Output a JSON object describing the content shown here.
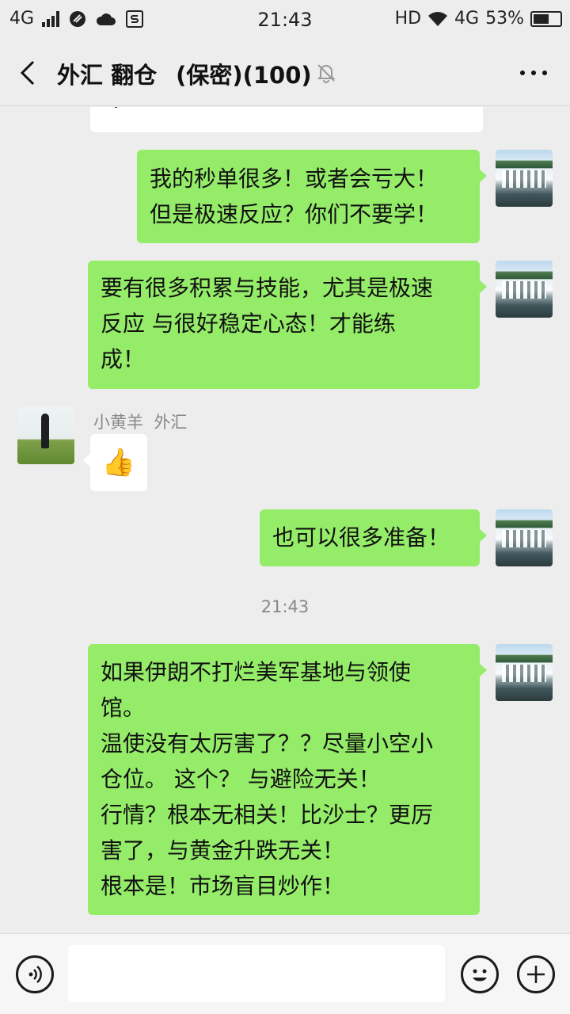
{
  "status_bar": {
    "network_left": "4G",
    "time": "21:43",
    "hd": "HD",
    "network_right": "4G",
    "battery": "53%",
    "icons": [
      "signal-bars-icon",
      "app-notification-icon",
      "cloud-icon",
      "s-app-icon",
      "wifi-icon",
      "battery-icon"
    ]
  },
  "header": {
    "title_part1": "外汇 翻仓",
    "title_part2": "(保密)(100)",
    "icons": [
      "back-arrow-icon",
      "mute-bell-icon",
      "more-dots-icon"
    ]
  },
  "messages": [
    {
      "sender": "me",
      "lines": [
        "我的秒单很多！或者会亏大！",
        "但是极速反应？你们不要学！"
      ]
    },
    {
      "sender": "me",
      "lines": [
        "要有很多积累与技能，尤其是极速",
        "反应  与很好稳定心态！才能练",
        "成！"
      ]
    },
    {
      "sender": "other",
      "name": "小黄羊  外汇",
      "emoji": "👍"
    },
    {
      "sender": "me",
      "lines": [
        "也可以很多准备！"
      ]
    },
    {
      "sender": "me",
      "lines": [
        "如果伊朗不打烂美军基地与领使",
        "馆。",
        "温使没有太厉害了？？尽量小空小",
        "仓位。  这个？  与避险无关！",
        "行情？根本无相关！比沙士？更厉",
        "害了，与黄金升跌无关！",
        "根本是！市场盲目炒作！"
      ]
    }
  ],
  "timestamp": "21:43",
  "input_bar": {
    "placeholder": "",
    "icons": [
      "voice-icon",
      "emoji-icon",
      "plus-icon"
    ]
  }
}
